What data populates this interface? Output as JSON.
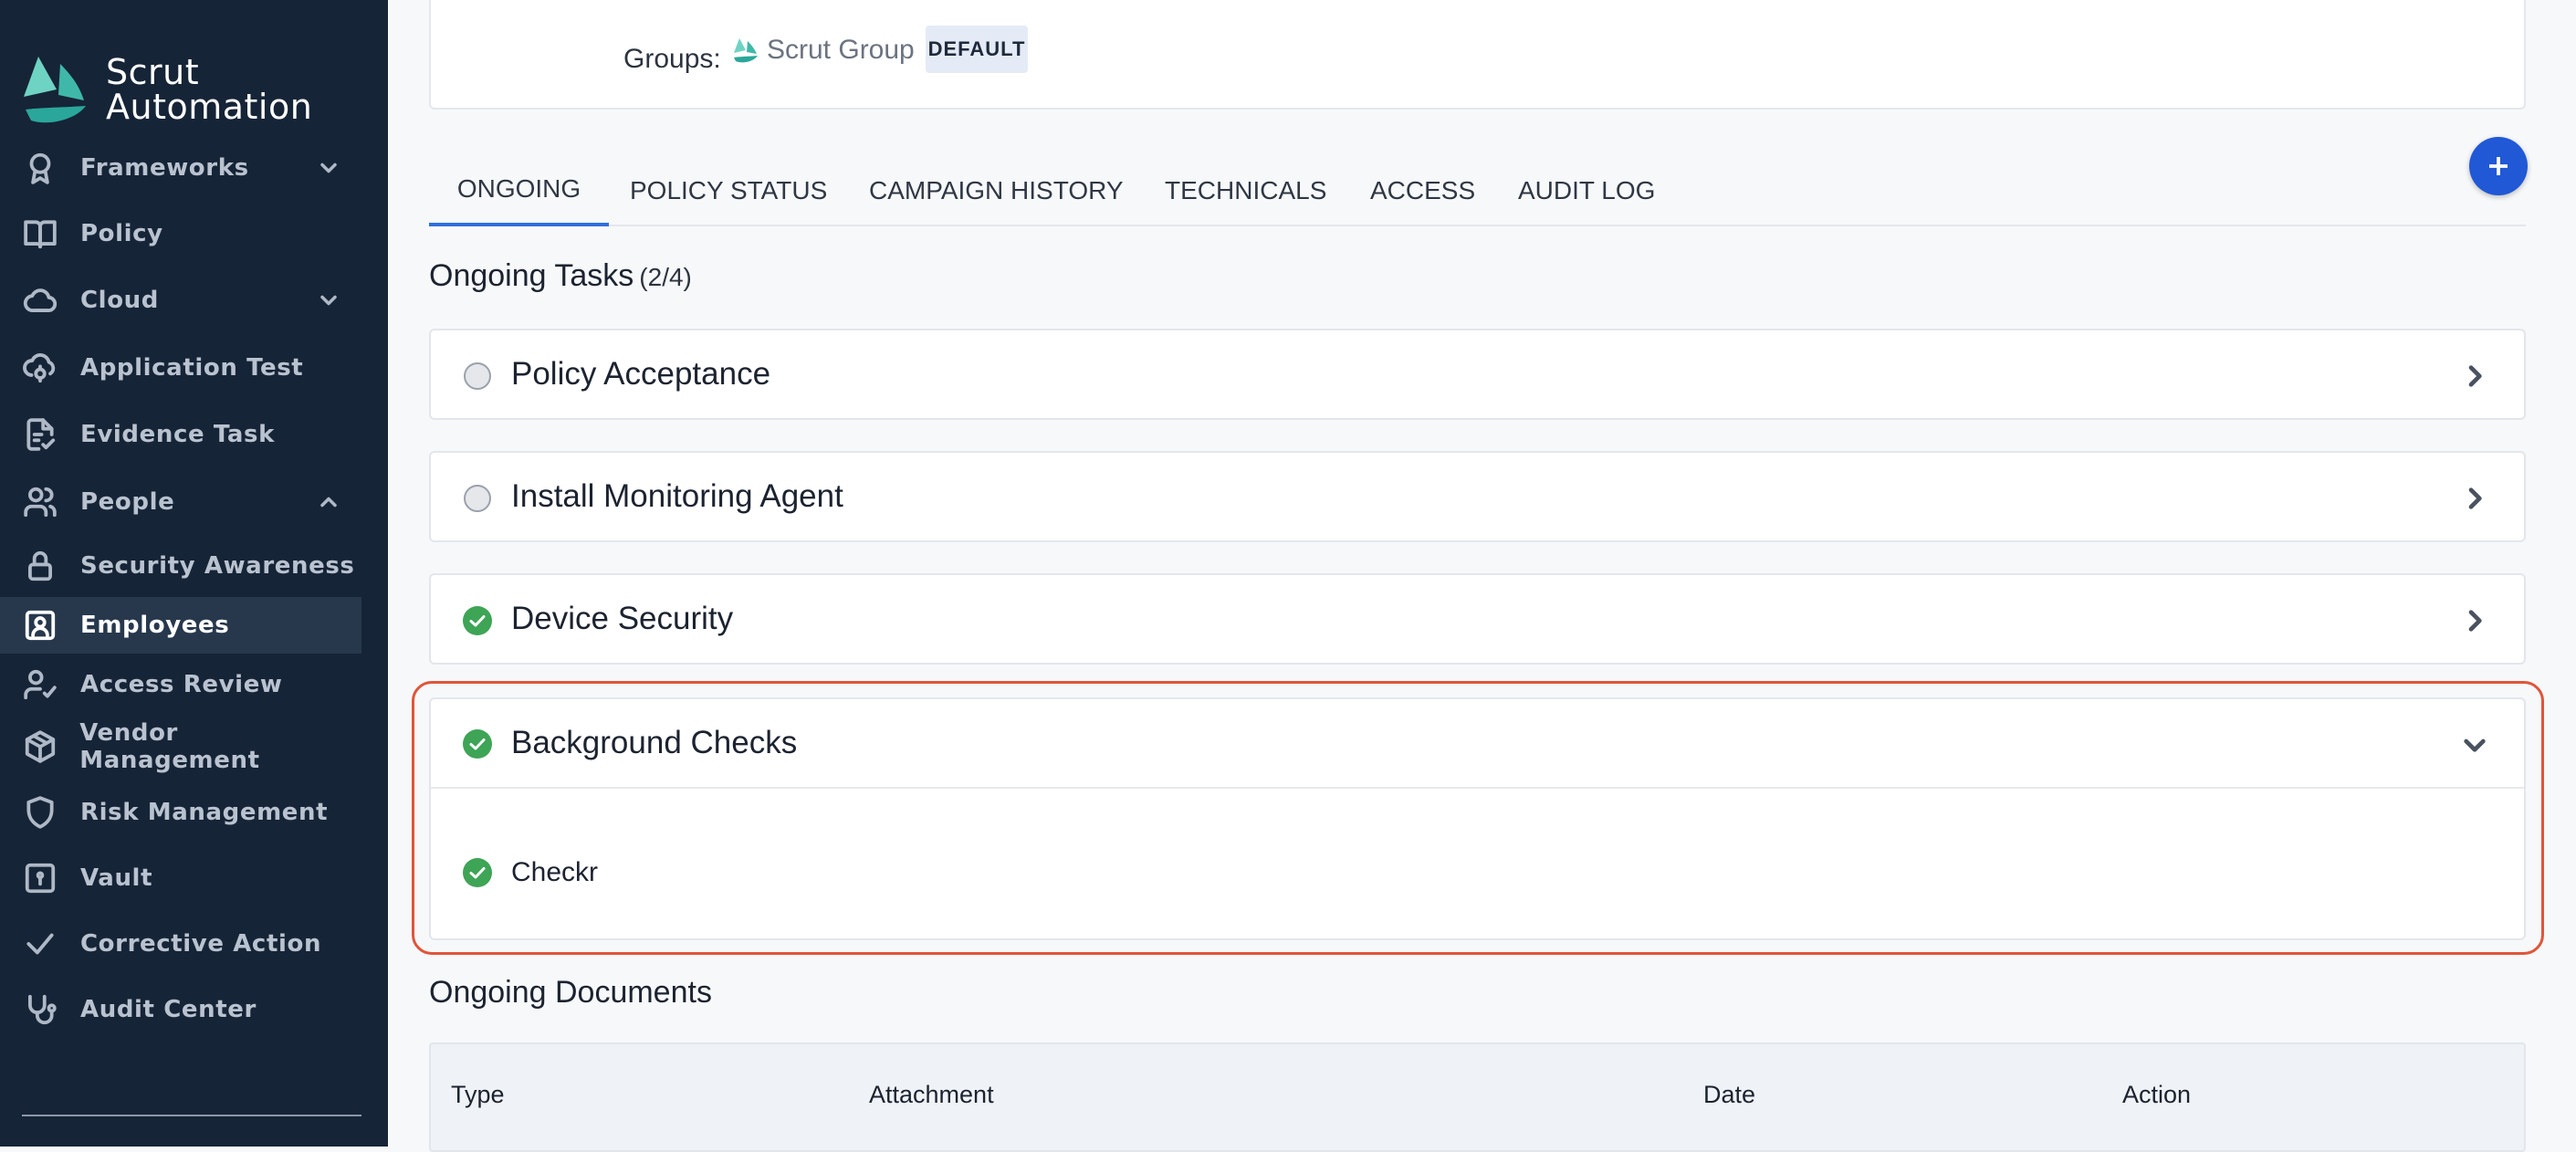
{
  "app": {
    "brand_line1": "Scrut",
    "brand_line2": "Automation"
  },
  "sidebar": {
    "items": [
      {
        "label": "Frameworks",
        "icon": "award-icon",
        "chevron": "down"
      },
      {
        "label": "Policy",
        "icon": "book-icon"
      },
      {
        "label": "Cloud",
        "icon": "cloud-icon",
        "chevron": "down"
      },
      {
        "label": "Application Test",
        "icon": "cloud-scan-icon"
      },
      {
        "label": "Evidence Task",
        "icon": "file-check-icon"
      },
      {
        "label": "People",
        "icon": "users-icon",
        "chevron": "up"
      },
      {
        "label": "Security Awareness",
        "icon": "lock-icon"
      },
      {
        "label": "Employees",
        "icon": "contact-card-icon",
        "active": true
      },
      {
        "label": "Access Review",
        "icon": "user-check-icon"
      },
      {
        "label": "Vendor Management",
        "icon": "package-icon"
      },
      {
        "label": "Risk Management",
        "icon": "shield-icon"
      },
      {
        "label": "Vault",
        "icon": "safe-icon"
      },
      {
        "label": "Corrective Action",
        "icon": "check-icon"
      },
      {
        "label": "Audit Center",
        "icon": "stethoscope-icon"
      }
    ]
  },
  "profile": {
    "groups_label": "Groups:",
    "group_name": "Scrut Group",
    "group_badge": "DEFAULT"
  },
  "tabs": [
    {
      "label": "ONGOING",
      "active": true
    },
    {
      "label": "POLICY STATUS"
    },
    {
      "label": "CAMPAIGN HISTORY"
    },
    {
      "label": "TECHNICALS"
    },
    {
      "label": "ACCESS"
    },
    {
      "label": "AUDIT LOG"
    }
  ],
  "ongoing_tasks": {
    "title": "Ongoing Tasks",
    "count": "(2/4)",
    "tasks": [
      {
        "name": "Policy Acceptance",
        "completed": false
      },
      {
        "name": "Install Monitoring Agent",
        "completed": false
      },
      {
        "name": "Device Security",
        "completed": true
      },
      {
        "name": "Background Checks",
        "completed": true,
        "expanded": true,
        "subtasks": [
          {
            "name": "Checkr",
            "completed": true
          }
        ]
      }
    ]
  },
  "ongoing_documents": {
    "title": "Ongoing Documents",
    "columns": [
      "Type",
      "Attachment",
      "Date",
      "Action"
    ]
  },
  "colors": {
    "sidebar_bg": "#162437",
    "accent": "#2058d6",
    "success": "#3ea456",
    "highlight": "#e0553a"
  }
}
